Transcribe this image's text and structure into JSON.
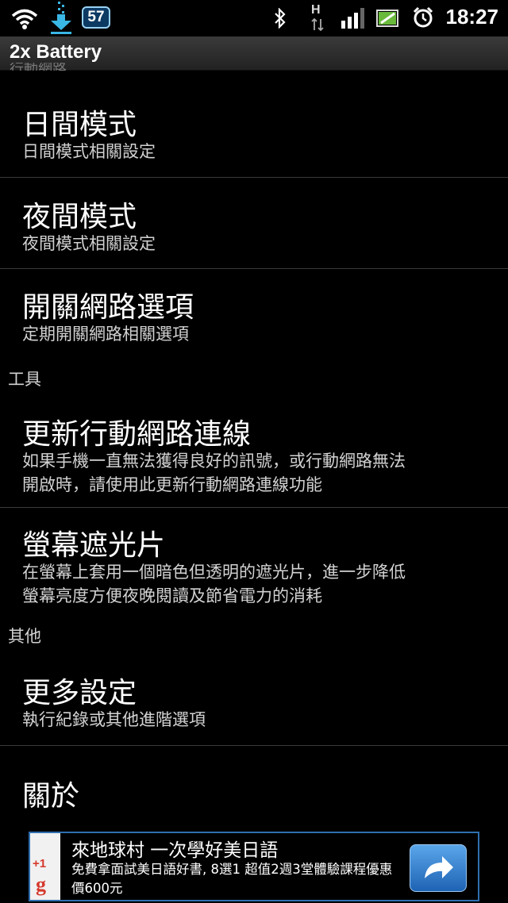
{
  "status_bar": {
    "time": "18:27",
    "notification_count": "57",
    "network_type": "H",
    "icons": [
      "wifi-icon",
      "download-icon",
      "notification-badge",
      "bluetooth-icon",
      "hspa-icon",
      "signal-icon",
      "battery-icon",
      "alarm-icon"
    ]
  },
  "app": {
    "title": "2x Battery"
  },
  "list": {
    "clipped_header": "行動網路",
    "items": [
      {
        "title": "日間模式",
        "summary": "日間模式相關設定"
      },
      {
        "title": "夜間模式",
        "summary": "夜間模式相關設定"
      },
      {
        "title": "開關網路選項",
        "summary": "定期開關網路相關選項"
      },
      {
        "title": "更新行動網路連線",
        "summary_line1": "如果手機一直無法獲得良好的訊號，或行動網路無法",
        "summary_line2": "開啟時，請使用此更新行動網路連線功能"
      },
      {
        "title": "螢幕遮光片",
        "summary_line1": "在螢幕上套用一個暗色但透明的遮光片，進一步降低",
        "summary_line2": "螢幕亮度方便夜晚閱讀及節省電力的消耗"
      },
      {
        "title": "更多設定",
        "summary": "執行紀錄或其他進階選項"
      },
      {
        "title": "關於"
      }
    ],
    "sections": {
      "tools": "工具",
      "other": "其他"
    }
  },
  "ad": {
    "title": "來地球村 一次學好美日語",
    "body": "免費拿面試美日語好書, 8選1 超值2週3堂體驗課程優惠價600元",
    "plus_one": "+1",
    "g_letter": "g"
  },
  "colors": {
    "background": "#000000",
    "title_bar": "#2c2c2c",
    "summary_text": "#d2d2d2",
    "ad_accent": "#2f6fb0"
  }
}
